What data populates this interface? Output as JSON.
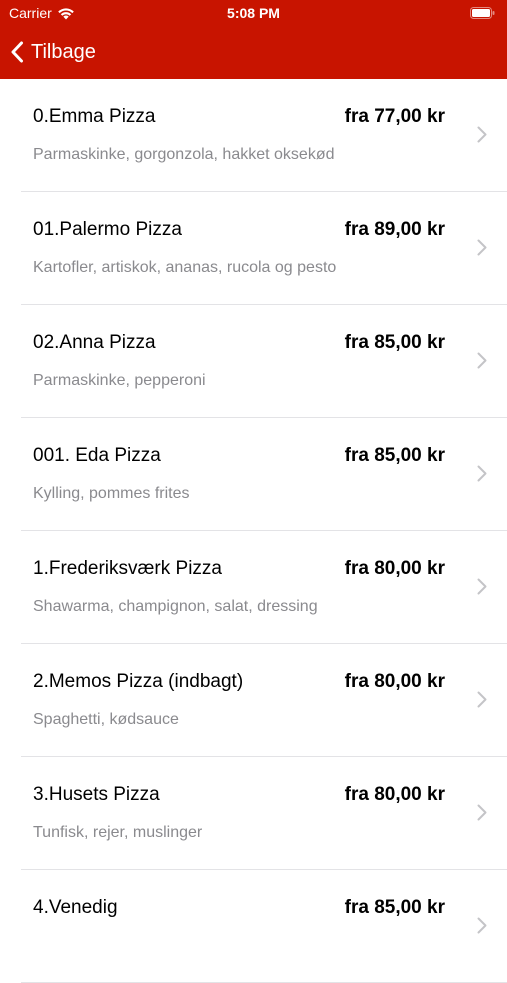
{
  "status_bar": {
    "carrier": "Carrier",
    "time": "5:08 PM"
  },
  "nav": {
    "back_label": "Tilbage"
  },
  "colors": {
    "header": "#c81400",
    "separator": "#e3e3e6",
    "description": "#8a8a8e"
  },
  "items": [
    {
      "name": "0.Emma Pizza",
      "price": "fra 77,00 kr",
      "description": "Parmaskinke, gorgonzola, hakket oksekød"
    },
    {
      "name": "01.Palermo Pizza",
      "price": "fra 89,00 kr",
      "description": "Kartofler, artiskok, ananas, rucola og pesto"
    },
    {
      "name": "02.Anna Pizza",
      "price": "fra 85,00 kr",
      "description": "Parmaskinke, pepperoni"
    },
    {
      "name": "001. Eda Pizza",
      "price": "fra 85,00 kr",
      "description": "Kylling, pommes frites"
    },
    {
      "name": "1.Frederiksværk Pizza",
      "price": "fra 80,00 kr",
      "description": "Shawarma, champignon, salat, dressing"
    },
    {
      "name": "2.Memos Pizza (indbagt)",
      "price": "fra 80,00 kr",
      "description": "Spaghetti, kødsauce"
    },
    {
      "name": "3.Husets Pizza",
      "price": "fra 80,00 kr",
      "description": "Tunfisk, rejer, muslinger"
    },
    {
      "name": "4.Venedig",
      "price": "fra 85,00 kr",
      "description": ""
    }
  ]
}
